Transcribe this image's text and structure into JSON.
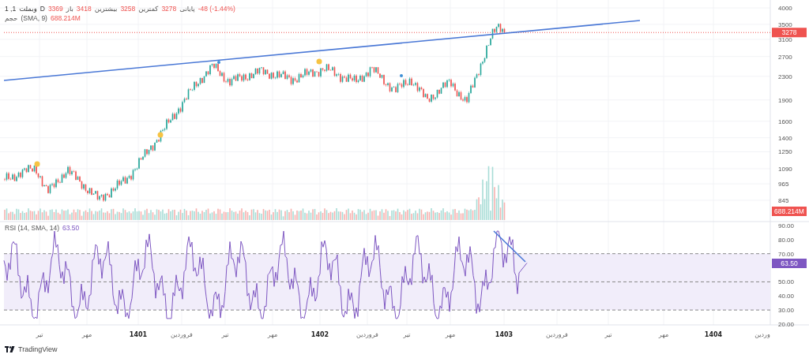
{
  "legend": {
    "change": "-48 (-1.44%)",
    "ohlc": [
      {
        "label": "پایانی",
        "value": "3278"
      },
      {
        "label": "کمترین",
        "value": "3258"
      },
      {
        "label": "بیشترین",
        "value": "3418"
      },
      {
        "label": "باز",
        "value": "3369"
      }
    ],
    "symbol": [
      "D",
      "وبملت",
      "1 ,1"
    ]
  },
  "volume_legend": {
    "label": "حجم",
    "params": "(SMA, 9)",
    "value": "688.214M"
  },
  "rsi_legend": {
    "params": "RSI (14, SMA, 14)",
    "value": "63.50"
  },
  "price_axis": [
    "4000",
    "3500",
    "3100",
    "2700",
    "2300",
    "1900",
    "1600",
    "1400",
    "1250",
    "1090",
    "965",
    "845"
  ],
  "price_badge": "3278",
  "volume_badge": "688.214M",
  "rsi_axis": [
    "90.00",
    "80.00",
    "70.00",
    "50.00",
    "40.00",
    "30.00",
    "20.00"
  ],
  "rsi_badge": "63.50",
  "time_axis": [
    {
      "label": "وردین",
      "major": false
    },
    {
      "label": "1404",
      "major": true
    },
    {
      "label": "مهر",
      "major": false
    },
    {
      "label": "تیر",
      "major": false
    },
    {
      "label": "فروردین",
      "major": false
    },
    {
      "label": "1403",
      "major": true
    },
    {
      "label": "مهر",
      "major": false
    },
    {
      "label": "تیر",
      "major": false
    },
    {
      "label": "فروردین",
      "major": false
    },
    {
      "label": "1402",
      "major": true
    },
    {
      "label": "مهر",
      "major": false
    },
    {
      "label": "تیر",
      "major": false
    },
    {
      "label": "فروردین",
      "major": false
    },
    {
      "label": "1401",
      "major": true
    },
    {
      "label": "مهر",
      "major": false
    },
    {
      "label": "تیر",
      "major": false
    }
  ],
  "footer": {
    "brand": "TradingView"
  }
}
